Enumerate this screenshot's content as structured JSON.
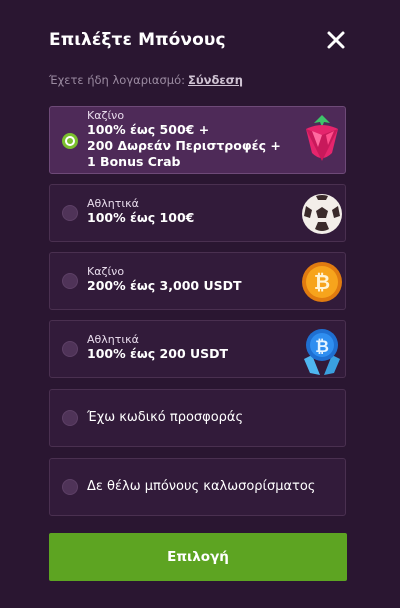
{
  "header": {
    "title": "Επιλέξτε Μπόνους"
  },
  "login": {
    "prompt": "Έχετε ήδη λογαριασμό:",
    "link": "Σύνδεση"
  },
  "options": [
    {
      "category": "Καζίνο",
      "lines": [
        "100% έως 500€ +",
        "200 Δωρεάν Περιστροφές +",
        "1 Bonus Crab"
      ],
      "icon": "strawberry-icon",
      "selected": true
    },
    {
      "category": "Αθλητικά",
      "lines": [
        "100% έως 100€"
      ],
      "icon": "soccer-ball-icon",
      "selected": false
    },
    {
      "category": "Καζίνο",
      "lines": [
        "200% έως 3,000 USDT"
      ],
      "icon": "bitcoin-coin-icon",
      "selected": false
    },
    {
      "category": "Αθλητικά",
      "lines": [
        "100% έως 200 USDT"
      ],
      "icon": "bitcoin-crystal-icon",
      "selected": false
    },
    {
      "label": "Έχω κωδικό προσφοράς",
      "selected": false
    },
    {
      "label": "Δε θέλω μπόνους καλωσορίσματος",
      "selected": false
    }
  ],
  "cta": {
    "label": "Επιλογή"
  },
  "colors": {
    "background": "#2a1631",
    "selected_option": "#4e2a58",
    "radio_accent": "#7bc02e",
    "cta": "#5da422"
  }
}
